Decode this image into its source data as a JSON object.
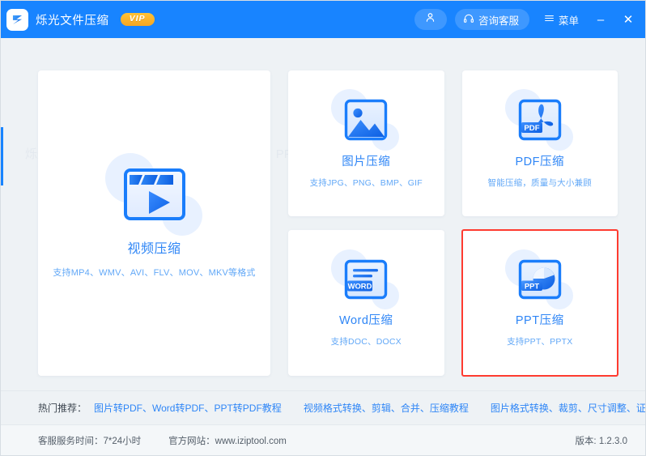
{
  "titlebar": {
    "logo_icon": "app-logo-icon",
    "app_name": "烁光文件压缩",
    "vip_badge": "VIP",
    "user_icon": "user-account-icon",
    "service_icon": "headset-icon",
    "service_label": "咨询客服",
    "menu_icon": "hamburger-menu-icon",
    "menu_label": "菜单",
    "minimize_label": "–",
    "close_label": "✕",
    "background_color": "#1884ff"
  },
  "watermark": "烁光文件压缩  支持视频、图片、PDF、Word、PPT等多种文件格式的智能压缩",
  "cards": {
    "video": {
      "title": "视频压缩",
      "subtitle": "支持MP4、WMV、AVI、FLV、MOV、MKV等格式",
      "icon": "video-play-icon"
    },
    "image": {
      "title": "图片压缩",
      "subtitle": "支持JPG、PNG、BMP、GIF",
      "icon": "picture-icon"
    },
    "pdf": {
      "title": "PDF压缩",
      "subtitle": "智能压缩，质量与大小兼顾",
      "icon": "pdf-file-icon"
    },
    "word": {
      "title": "Word压缩",
      "subtitle": "支持DOC、DOCX",
      "icon": "word-file-icon"
    },
    "ppt": {
      "title": "PPT压缩",
      "subtitle": "支持PPT、PPTX",
      "icon": "ppt-file-icon",
      "highlight_color": "#ff3b30"
    }
  },
  "recommend": {
    "label": "热门推荐：",
    "links": [
      "图片转PDF、Word转PDF、PPT转PDF教程",
      "视频格式转换、剪辑、合并、压缩教程",
      "图片格式转换、裁剪、尺寸调整、证件照大小调整"
    ]
  },
  "footer": {
    "service_hours": "客服服务时间：7*24小时",
    "website": "官方网站：www.iziptool.com",
    "version": "版本: 1.2.3.0"
  },
  "colors": {
    "brand_blue": "#1884ff",
    "card_title_blue": "#2f86f6",
    "vip_gold": "#f5a623",
    "highlight_red": "#ff3b30",
    "page_bg": "#eef2f5"
  }
}
